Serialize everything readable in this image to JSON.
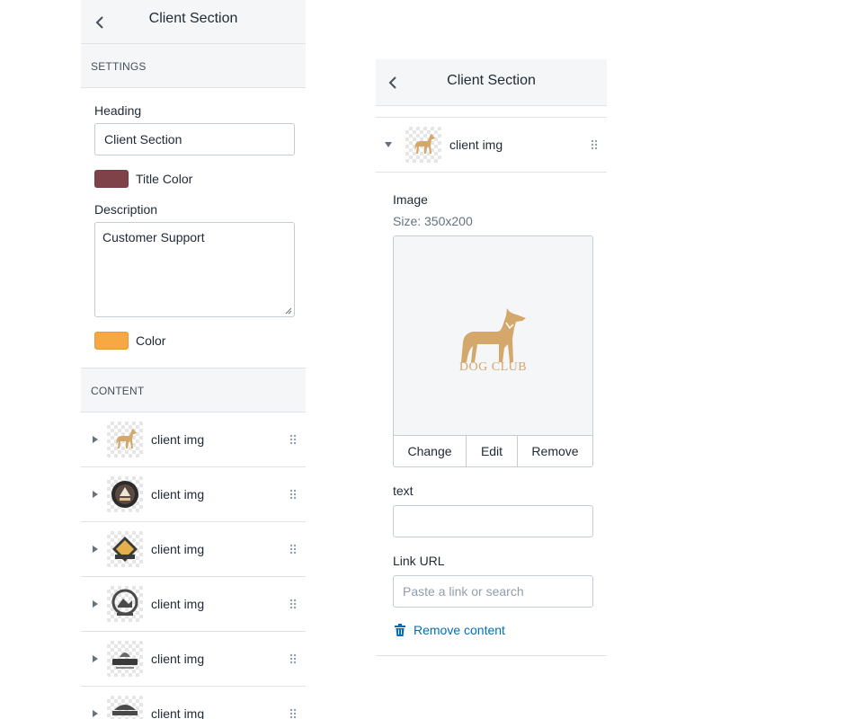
{
  "colors": {
    "title_color": "#7f4249",
    "description_color": "#f7a843",
    "link_blue": "#006fbb"
  },
  "left": {
    "title": "Client Section",
    "settings_header": "SETTINGS",
    "heading_label": "Heading",
    "heading_value": "Client Section",
    "title_color_label": "Title Color",
    "description_label": "Description",
    "description_value": "Customer Support",
    "color_label": "Color",
    "content_header": "CONTENT",
    "blocks": [
      {
        "label": "client img",
        "thumb_icon": "dog-club-logo-icon"
      },
      {
        "label": "client img",
        "thumb_icon": "round-badge-logo-icon"
      },
      {
        "label": "client img",
        "thumb_icon": "diamond-badge-logo-icon"
      },
      {
        "label": "client img",
        "thumb_icon": "circle-emblem-logo-icon"
      },
      {
        "label": "client img",
        "thumb_icon": "dog-food-logo-icon"
      },
      {
        "label": "client img",
        "thumb_icon": "banner-logo-icon"
      }
    ]
  },
  "right": {
    "title": "Client Section",
    "block_label": "client img",
    "image_label": "Image",
    "size_text": "Size: 350x200",
    "logo_text": "DOG CLUB",
    "change_label": "Change",
    "edit_label": "Edit",
    "remove_label": "Remove",
    "text_label": "text",
    "text_value": "",
    "link_label": "Link URL",
    "link_placeholder": "Paste a link or search",
    "remove_content_label": "Remove content"
  }
}
